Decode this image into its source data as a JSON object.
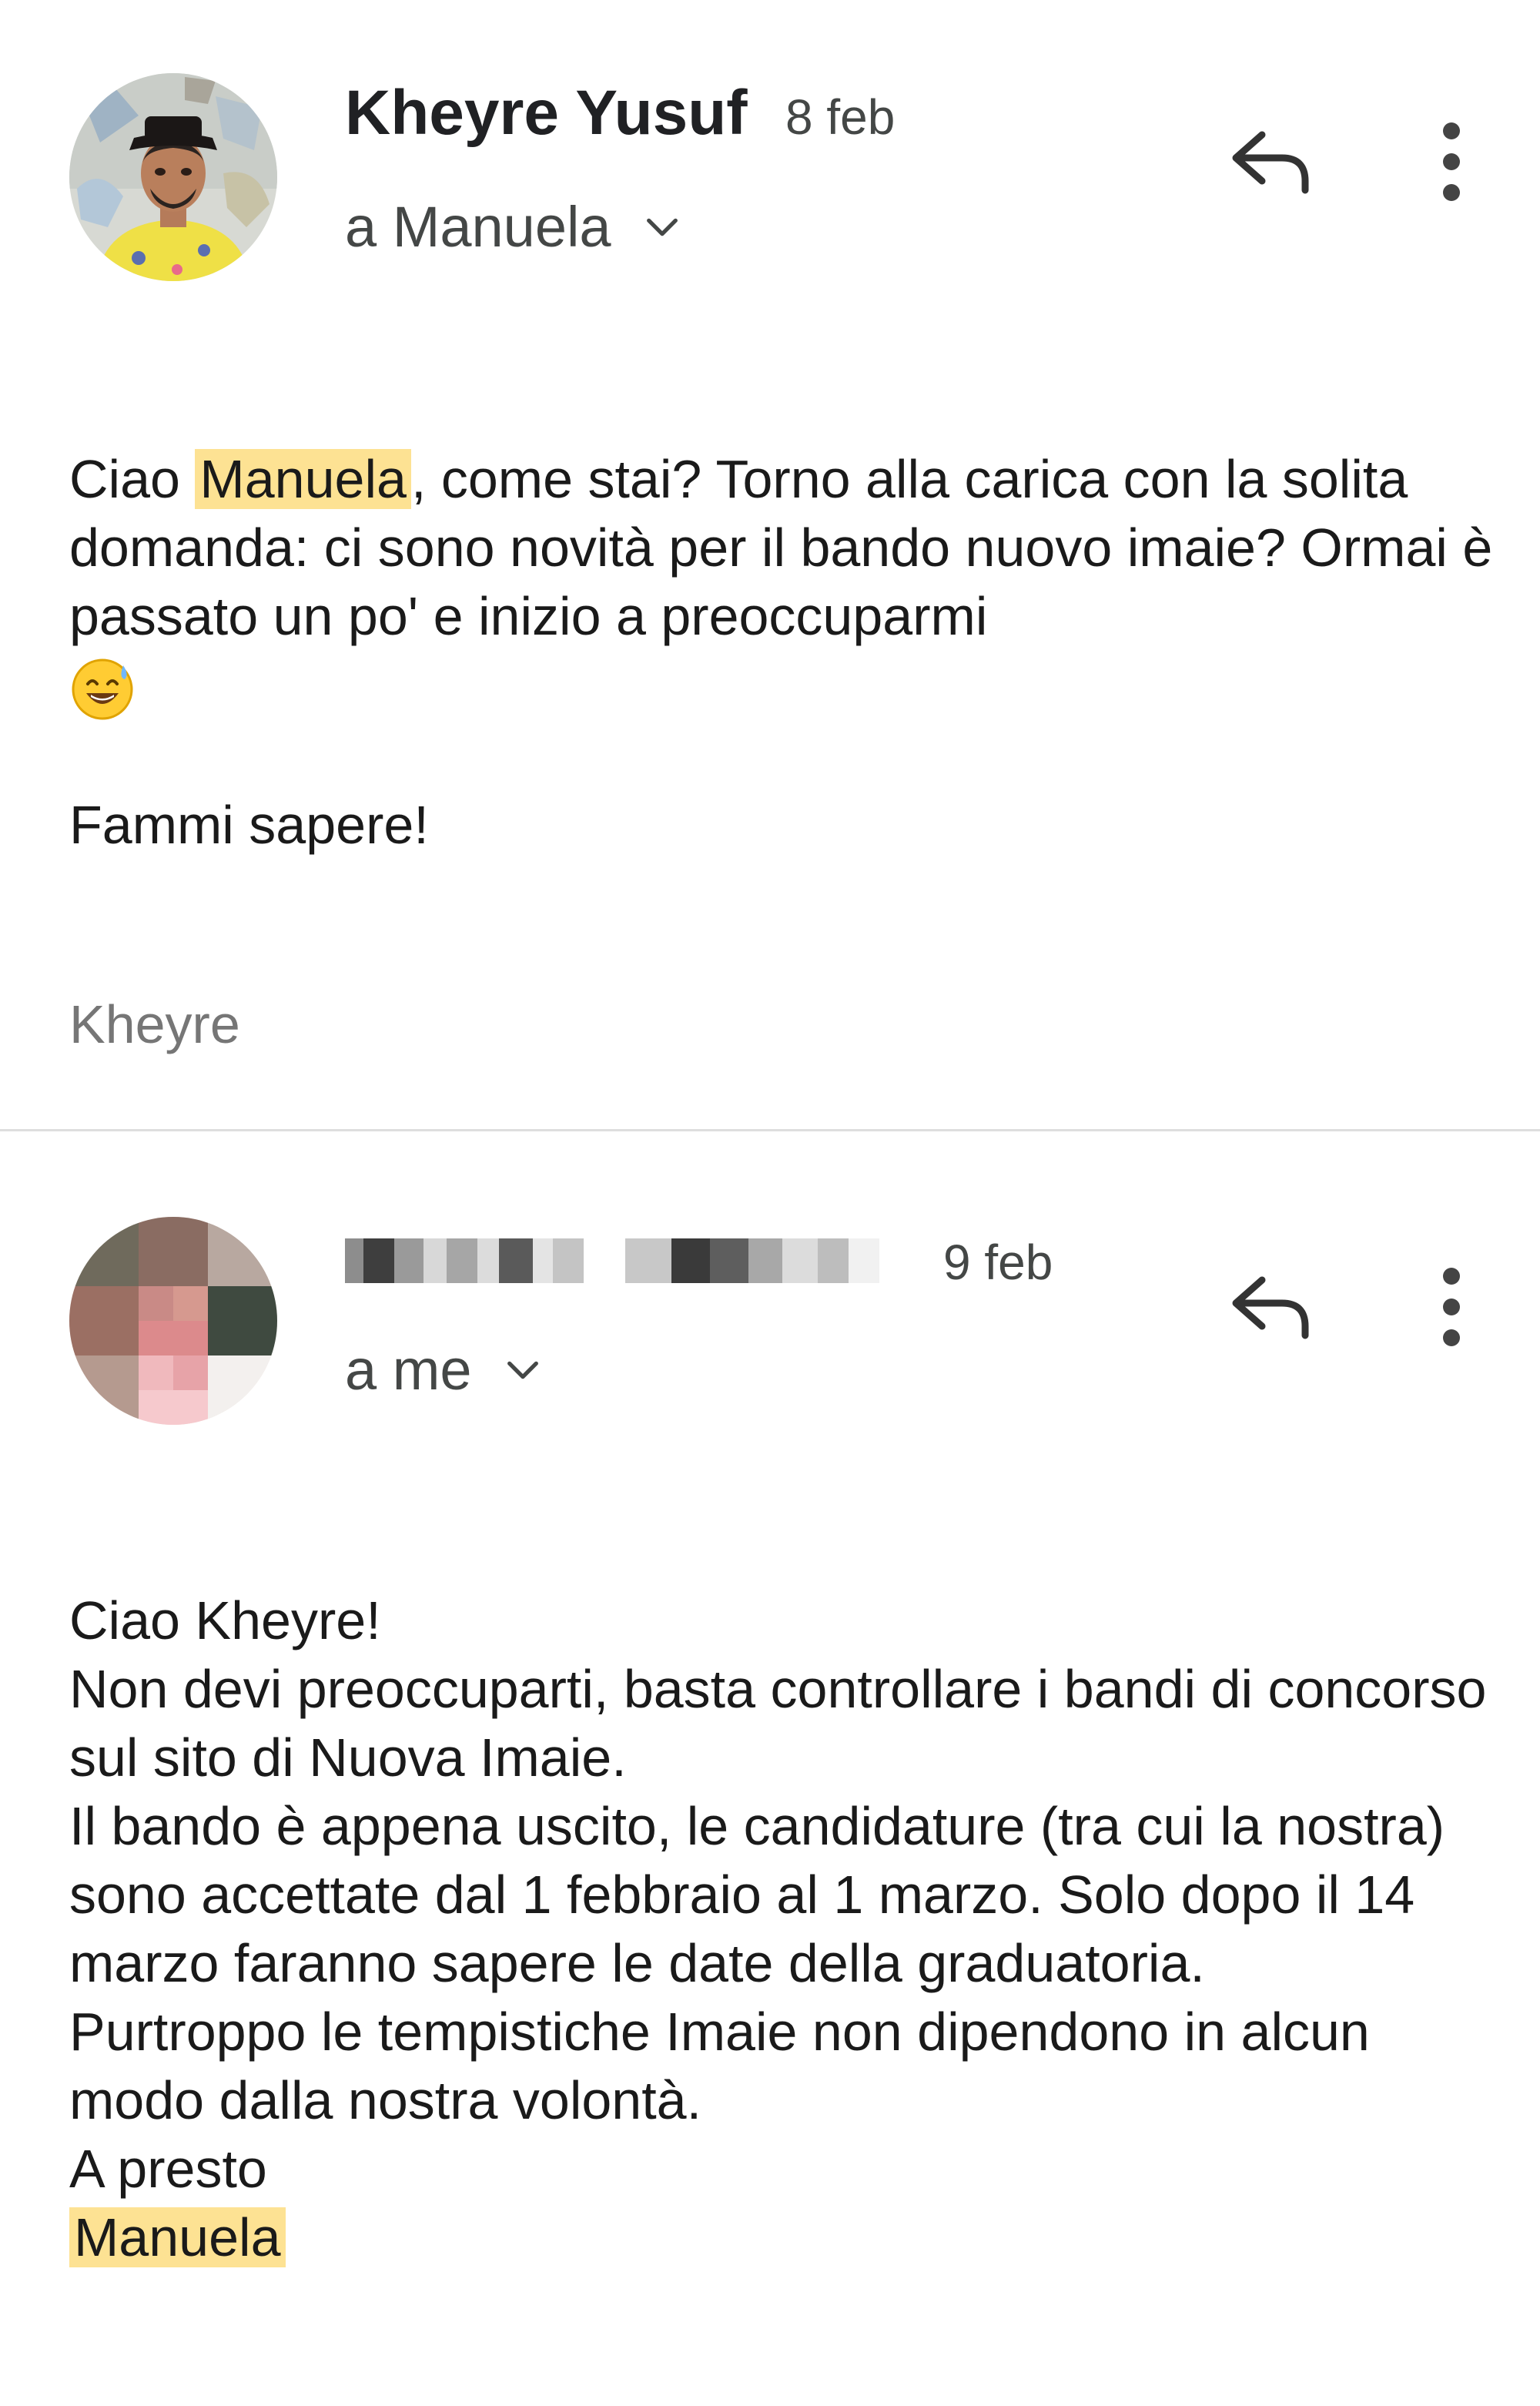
{
  "messages": [
    {
      "sender": "Kheyre Yusuf",
      "date": "8 feb",
      "recipient": "a Manuela",
      "greeting_start": "Ciao ",
      "greeting_name": "Manuela",
      "paragraph1": ", come stai? Torno alla carica con la solita domanda: ci sono novità per il bando nuovo imaie? Ormai è passato un po' e inizio a preoccuparmi",
      "emoji": "😅",
      "paragraph2": "Fammi sapere!",
      "signature": "Kheyre"
    },
    {
      "date": "9 feb",
      "recipient": "a me",
      "lines": [
        "Ciao Kheyre!",
        "Non devi preoccuparti, basta controllare i bandi di concorso sul sito di Nuova Imaie.",
        "Il bando è appena uscito, le candidature (tra cui la nostra) sono accettate dal 1 febbraio al 1 marzo. Solo dopo il 14 marzo faranno sapere le date della graduatoria.",
        "Purtroppo le tempistiche Imaie non dipendono in alcun modo dalla nostra volontà.",
        "A presto"
      ],
      "signature_name": "Manuela"
    }
  ],
  "colors": {
    "highlight": "#fde293",
    "text": "#1a1a1a",
    "secondary": "#444746",
    "divider": "#dedede"
  },
  "icons": {
    "reply": "reply-icon",
    "more": "more-vert-icon",
    "expand": "chevron-down-icon"
  }
}
